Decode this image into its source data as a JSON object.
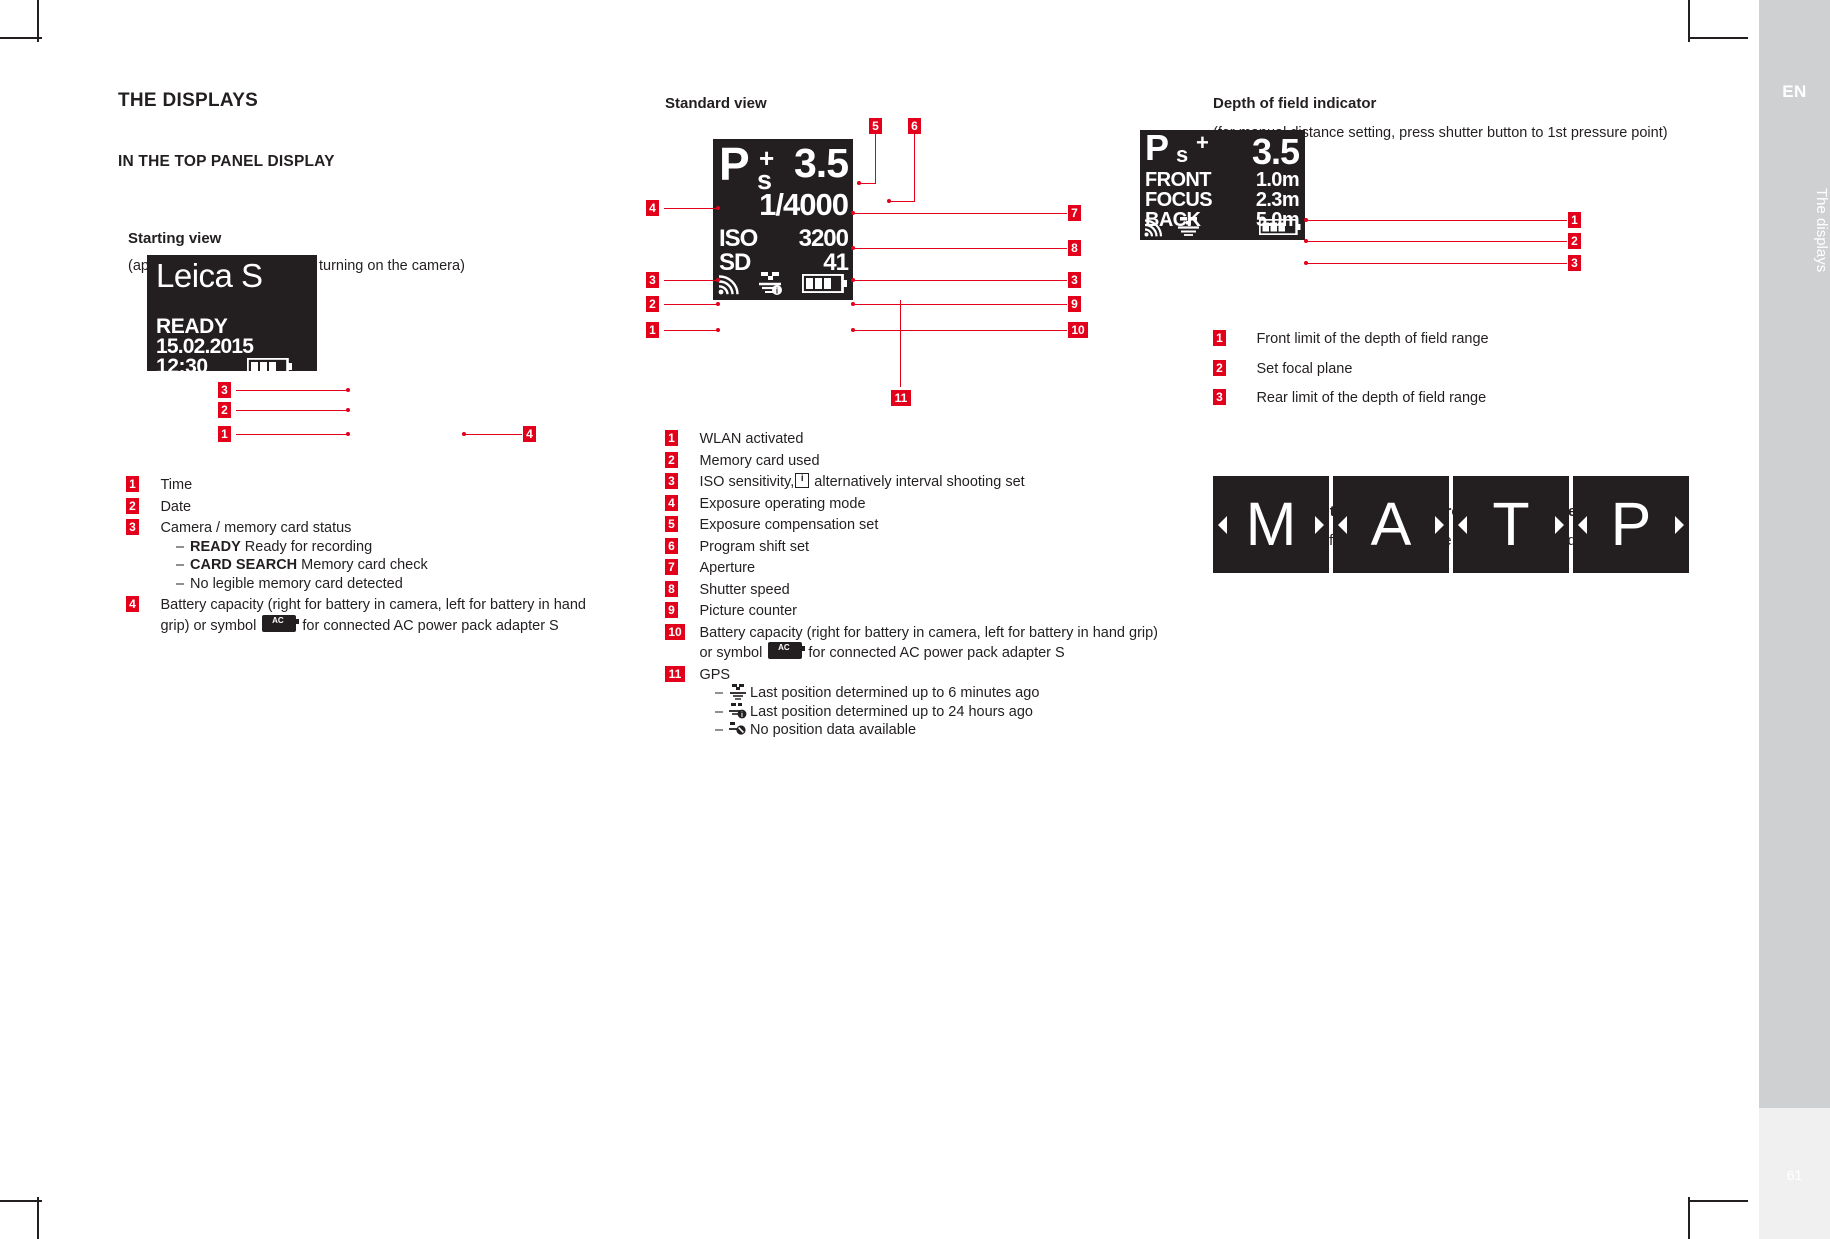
{
  "sidebar": {
    "language": "EN",
    "running_head": "The displays",
    "page_number": "61"
  },
  "left_column": {
    "section_title": "THE DISPLAYS",
    "subsection_title": "IN THE TOP PANEL DISPLAY",
    "block_title": "Starting view",
    "block_note": "(appears for approx. 5 s after turning on the camera)",
    "lcd": {
      "brand": "Leica S",
      "status": "READY",
      "date": "15.02.2015",
      "time": "12:30",
      "battery_icon": "battery-icon"
    },
    "callouts": [
      {
        "id": "3",
        "target": "status"
      },
      {
        "id": "2",
        "target": "date"
      },
      {
        "id": "1",
        "target": "time"
      },
      {
        "id": "4",
        "target": "battery"
      }
    ],
    "legend": [
      {
        "num": "1",
        "text": "Time"
      },
      {
        "num": "2",
        "text": "Date"
      },
      {
        "num": "3",
        "text": "Camera / memory card status",
        "subitems": [
          {
            "bold": "READY",
            "rest": " Ready for recording"
          },
          {
            "bold": "CARD SEARCH",
            "rest": " Memory card check"
          },
          {
            "bold": "",
            "rest": "No legible memory card detected"
          }
        ]
      },
      {
        "num": "4",
        "text_before": "Battery capacity (right for battery in camera, left for battery in hand grip) or symbol ",
        "symbol": "ac-adapter-icon",
        "text_after": " for connected AC power pack adapter S"
      }
    ]
  },
  "middle_column": {
    "block_title": "Standard view",
    "lcd": {
      "mode": "P",
      "exposure_compensation": "+",
      "program_shift": "s",
      "aperture": "3.5",
      "shutter_speed": "1/4000",
      "iso_label": "ISO",
      "iso_value": "3200",
      "card_label": "SD",
      "picture_counter": "41",
      "wlan_icon": "wlan-icon",
      "gps_icon": "gps-satellite-icon",
      "battery_icon": "battery-icon"
    },
    "callouts": [
      "1",
      "2",
      "3",
      "4",
      "5",
      "6",
      "7",
      "8",
      "9",
      "10",
      "11"
    ],
    "legend": [
      {
        "num": "1",
        "text": "WLAN activated"
      },
      {
        "num": "2",
        "text": "Memory card used"
      },
      {
        "num": "3",
        "text_before": "ISO sensitivity,",
        "symbol": "info-icon",
        "text_after": " alternatively interval shooting set"
      },
      {
        "num": "4",
        "text": "Exposure operating mode"
      },
      {
        "num": "5",
        "text": "Exposure compensation set"
      },
      {
        "num": "6",
        "text": "Program shift set"
      },
      {
        "num": "7",
        "text": "Aperture"
      },
      {
        "num": "8",
        "text": "Shutter speed"
      },
      {
        "num": "9",
        "text": "Picture counter"
      },
      {
        "num": "10",
        "text_before": "Battery capacity (right for battery in camera, left for battery in hand grip) or symbol ",
        "symbol": "ac-adapter-icon",
        "text_after": " for connected AC power pack adapter S"
      },
      {
        "num": "11",
        "text": "GPS",
        "subitems": [
          {
            "icon": "gps-good-icon",
            "rest": "Last position determined up to 6 minutes ago"
          },
          {
            "icon": "gps-old-icon",
            "rest": "Last position determined up to 24 hours ago"
          },
          {
            "icon": "gps-none-icon",
            "rest": "No position data available"
          }
        ]
      }
    ]
  },
  "right_column": {
    "dof": {
      "title": "Depth of field indicator",
      "note": "(for manual distance setting, press shutter button to 1st pressure point)",
      "lcd": {
        "mode": "P",
        "program_shift": "s",
        "exposure_compensation": "+",
        "aperture": "3.5",
        "rows": [
          {
            "label": "FRONT",
            "value": "1.0m"
          },
          {
            "label": "FOCUS",
            "value": "2.3m"
          },
          {
            "label": "BACK",
            "value": "5.0m"
          }
        ],
        "wlan_icon": "wlan-icon",
        "gps_icon": "gps-satellite-icon",
        "battery_icon": "battery-icon"
      },
      "callouts": [
        "1",
        "2",
        "3"
      ],
      "legend": [
        {
          "num": "1",
          "text": "Front limit of the depth of field range"
        },
        {
          "num": "2",
          "text": "Set focal plane"
        },
        {
          "num": "3",
          "text": "Rear limit of the depth of field range"
        }
      ]
    },
    "exposure_mode": {
      "title": "Display when setting the exposure operating mode",
      "note": "(appears only briefly after holding the rear thumbwheel depressed)",
      "tiles": [
        "M",
        "A",
        "T",
        "P"
      ]
    }
  },
  "colors": {
    "accent_red": "#e2001a",
    "ink": "#231f20",
    "tab_grey": "#cfd0d2",
    "tab_bg": "#f0f0f0"
  }
}
